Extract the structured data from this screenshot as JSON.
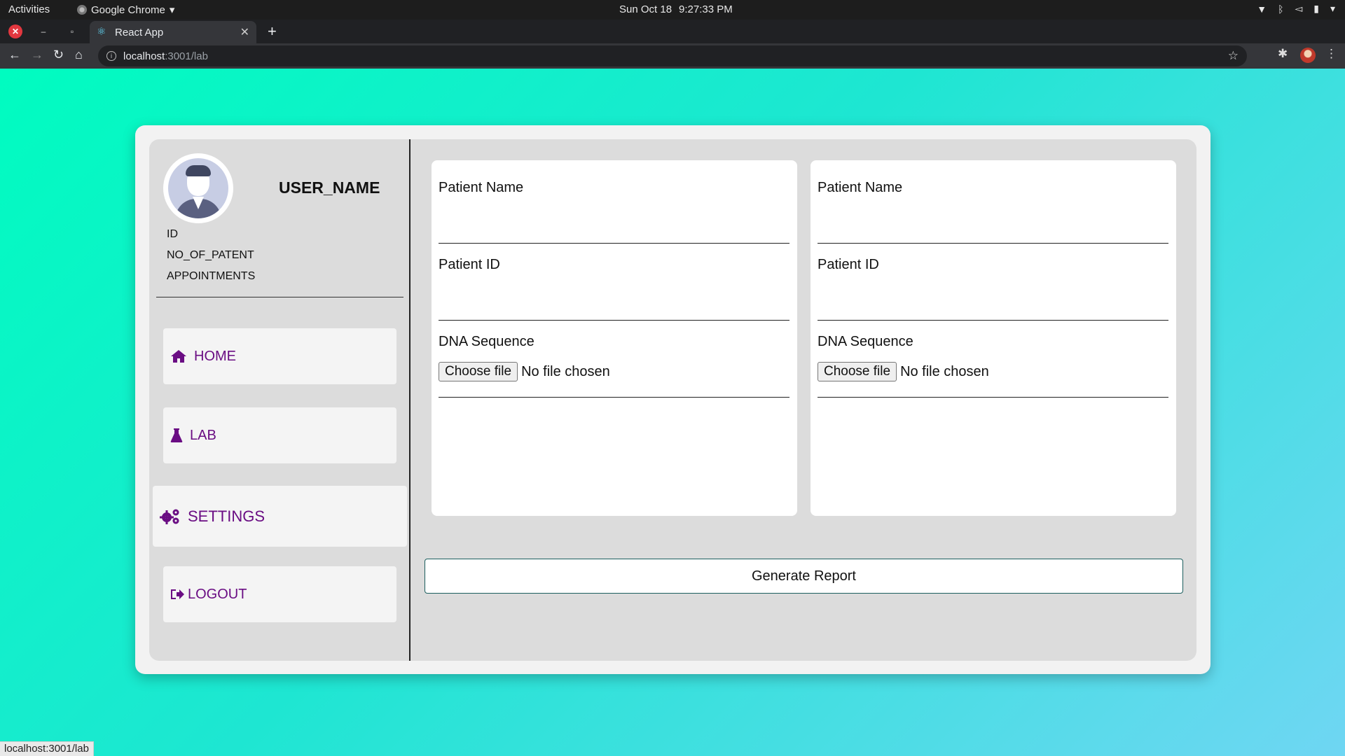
{
  "os_bar": {
    "activities": "Activities",
    "app_name": "Google Chrome",
    "date": "Sun Oct 18",
    "time": "9:27:33 PM"
  },
  "browser": {
    "tab_title": "React App",
    "url_host": "localhost",
    "url_path": ":3001/lab",
    "status_url": "localhost:3001/lab"
  },
  "profile": {
    "username": "USER_NAME",
    "id_label": "ID",
    "patients_label": "NO_OF_PATENT",
    "appointments_label": "APPOINTMENTS"
  },
  "nav": {
    "home": "HOME",
    "lab": "LAB",
    "settings": "SETTINGS",
    "logout": "LOGOUT"
  },
  "forms": [
    {
      "patient_name_label": "Patient Name",
      "patient_id_label": "Patient ID",
      "dna_label": "DNA Sequence",
      "file_button": "Choose file",
      "file_status": "No file chosen"
    },
    {
      "patient_name_label": "Patient Name",
      "patient_id_label": "Patient ID",
      "dna_label": "DNA Sequence",
      "file_button": "Choose file",
      "file_status": "No file chosen"
    }
  ],
  "generate_button": "Generate Report",
  "colors": {
    "nav_accent": "#6a0d83",
    "gradient_start": "#00fcc0",
    "gradient_end": "#6fd6f3"
  }
}
